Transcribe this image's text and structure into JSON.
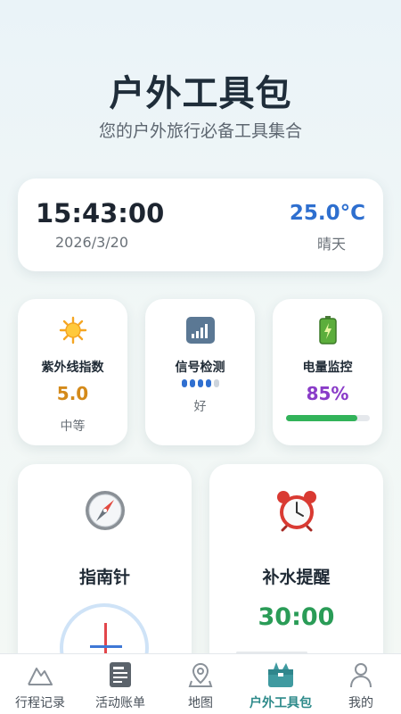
{
  "header": {
    "title": "户外工具包",
    "subtitle": "您的户外旅行必备工具集合"
  },
  "time_card": {
    "time": "15:43:00",
    "date": "2026/3/20",
    "temperature": "25.0°C",
    "weather": "晴天"
  },
  "mini_cards": {
    "uv": {
      "label": "紫外线指数",
      "value": "5.0",
      "level": "中等",
      "icon": "sun-icon",
      "color": "#d48a1a"
    },
    "signal": {
      "label": "信号检测",
      "quality": "好",
      "bars_on": 4,
      "bars_total": 5,
      "icon": "signal-icon"
    },
    "battery": {
      "label": "电量监控",
      "value": "85%",
      "level": 0.85,
      "icon": "battery-icon",
      "color": "#8a3cc8"
    }
  },
  "big_cards": {
    "compass": {
      "label": "指南针",
      "icon": "compass-icon"
    },
    "hydration": {
      "label": "补水提醒",
      "timer": "30:00",
      "icon": "alarm-clock-icon"
    }
  },
  "tabs": [
    {
      "label": "行程记录",
      "icon": "mountain-icon",
      "active": false
    },
    {
      "label": "活动账单",
      "icon": "receipt-icon",
      "active": false
    },
    {
      "label": "地图",
      "icon": "map-pin-icon",
      "active": false
    },
    {
      "label": "户外工具包",
      "icon": "toolbox-icon",
      "active": true
    },
    {
      "label": "我的",
      "icon": "user-icon",
      "active": false
    }
  ]
}
